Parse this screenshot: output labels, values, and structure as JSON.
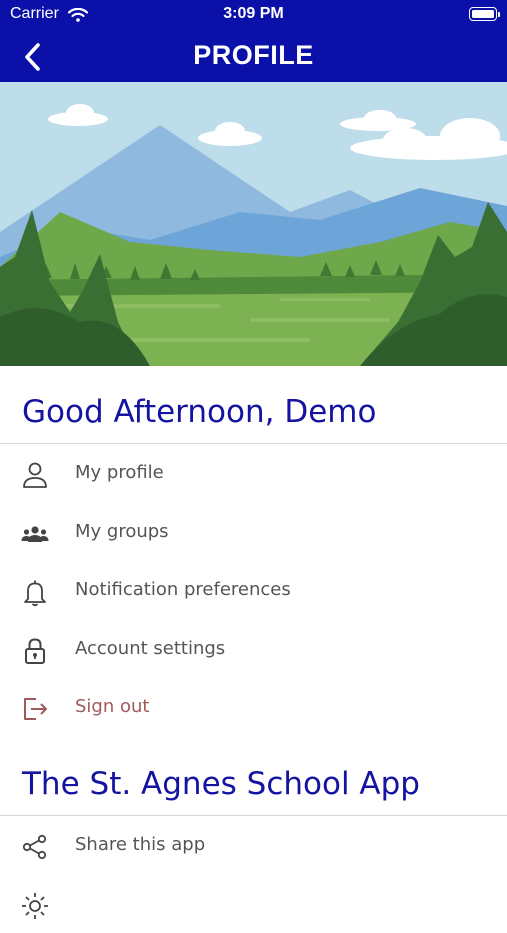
{
  "status_bar": {
    "carrier": "Carrier",
    "time": "3:09 PM"
  },
  "header": {
    "title": "PROFILE"
  },
  "greeting": "Good Afternoon, Demo",
  "account_menu": [
    {
      "label": "My profile",
      "icon": "person-icon"
    },
    {
      "label": "My groups",
      "icon": "group-icon"
    },
    {
      "label": "Notification preferences",
      "icon": "bell-icon"
    },
    {
      "label": "Account settings",
      "icon": "lock-icon"
    },
    {
      "label": "Sign out",
      "icon": "sign-out-icon"
    }
  ],
  "app_section_title": "The St. Agnes School App",
  "app_menu": [
    {
      "label": "Share this app",
      "icon": "share-icon"
    },
    {
      "label": "",
      "icon": "sun-icon"
    }
  ],
  "colors": {
    "header": "#0a10a8",
    "section_title": "#1414a0",
    "sign_out": "#a05a5a"
  }
}
